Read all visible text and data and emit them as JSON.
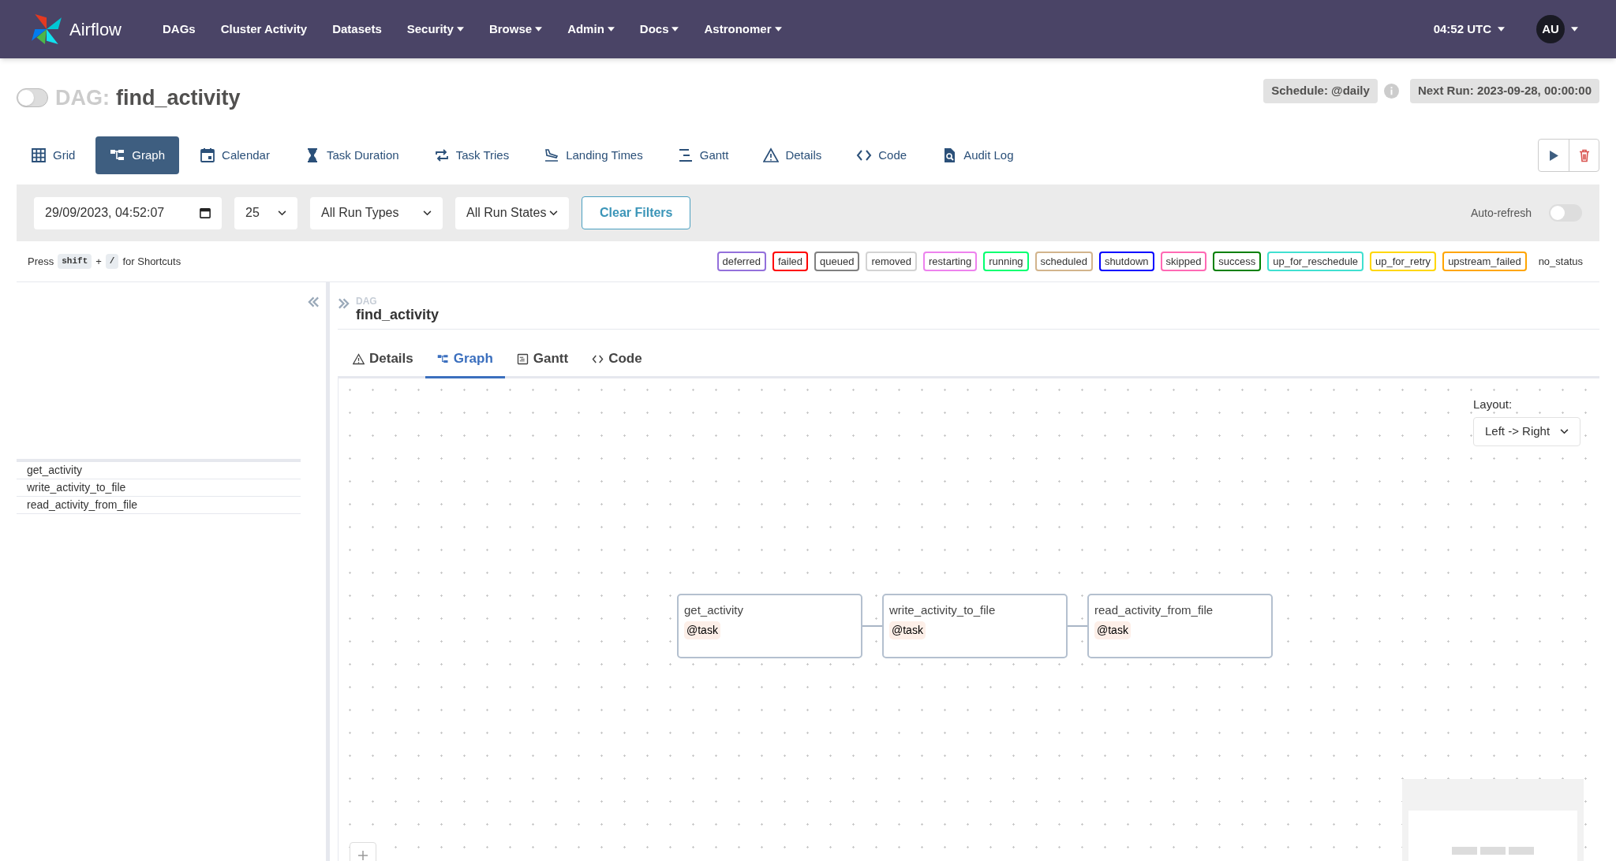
{
  "navbar": {
    "brand": "Airflow",
    "items": [
      {
        "label": "DAGs",
        "dropdown": false
      },
      {
        "label": "Cluster Activity",
        "dropdown": false
      },
      {
        "label": "Datasets",
        "dropdown": false
      },
      {
        "label": "Security",
        "dropdown": true
      },
      {
        "label": "Browse",
        "dropdown": true
      },
      {
        "label": "Admin",
        "dropdown": true
      },
      {
        "label": "Docs",
        "dropdown": true
      },
      {
        "label": "Astronomer",
        "dropdown": true
      }
    ],
    "time": "04:52 UTC",
    "user": "AU"
  },
  "dag_header": {
    "active": false,
    "prefix": "DAG:",
    "name": "find_activity",
    "schedule": "Schedule: @daily",
    "next_run": "Next Run: 2023-09-28, 00:00:00"
  },
  "view_tabs": [
    {
      "label": "Grid",
      "selected": false
    },
    {
      "label": "Graph",
      "selected": true
    },
    {
      "label": "Calendar",
      "selected": false
    },
    {
      "label": "Task Duration",
      "selected": false
    },
    {
      "label": "Task Tries",
      "selected": false
    },
    {
      "label": "Landing Times",
      "selected": false
    },
    {
      "label": "Gantt",
      "selected": false
    },
    {
      "label": "Details",
      "selected": false
    },
    {
      "label": "Code",
      "selected": false
    },
    {
      "label": "Audit Log",
      "selected": false
    }
  ],
  "filters": {
    "date": "29/09/2023, 04:52:07",
    "num_runs": "25",
    "run_type": "All Run Types",
    "run_state": "All Run States",
    "clear": "Clear Filters",
    "auto_refresh": {
      "label": "Auto-refresh",
      "on": false
    }
  },
  "shortcut_hint": {
    "press": "Press",
    "key1": "shift",
    "plus": "+",
    "key2": "/",
    "suffix": "for Shortcuts"
  },
  "legend": [
    {
      "label": "deferred",
      "color": "#9370db"
    },
    {
      "label": "failed",
      "color": "#ff0000"
    },
    {
      "label": "queued",
      "color": "#808080"
    },
    {
      "label": "removed",
      "color": "#d3d3d3"
    },
    {
      "label": "restarting",
      "color": "#ee82ee"
    },
    {
      "label": "running",
      "color": "#01ff70"
    },
    {
      "label": "scheduled",
      "color": "#d2b48c"
    },
    {
      "label": "shutdown",
      "color": "#0000ff"
    },
    {
      "label": "skipped",
      "color": "#ff69b4"
    },
    {
      "label": "success",
      "color": "#008000"
    },
    {
      "label": "up_for_reschedule",
      "color": "#40e0d0"
    },
    {
      "label": "up_for_retry",
      "color": "#ffd700"
    },
    {
      "label": "upstream_failed",
      "color": "#ffa500"
    },
    {
      "label": "no_status"
    }
  ],
  "task_list": [
    "get_activity",
    "write_activity_to_file",
    "read_activity_from_file"
  ],
  "details": {
    "kicker": "DAG",
    "name": "find_activity",
    "tabs": [
      {
        "label": "Details",
        "selected": false
      },
      {
        "label": "Graph",
        "selected": true
      },
      {
        "label": "Gantt",
        "selected": false
      },
      {
        "label": "Code",
        "selected": false
      }
    ],
    "layout_label": "Layout:",
    "layout": "Left -> Right",
    "nodes": [
      {
        "label": "get_activity",
        "decorator": "@task"
      },
      {
        "label": "write_activity_to_file",
        "decorator": "@task"
      },
      {
        "label": "read_activity_from_file",
        "decorator": "@task"
      }
    ]
  }
}
